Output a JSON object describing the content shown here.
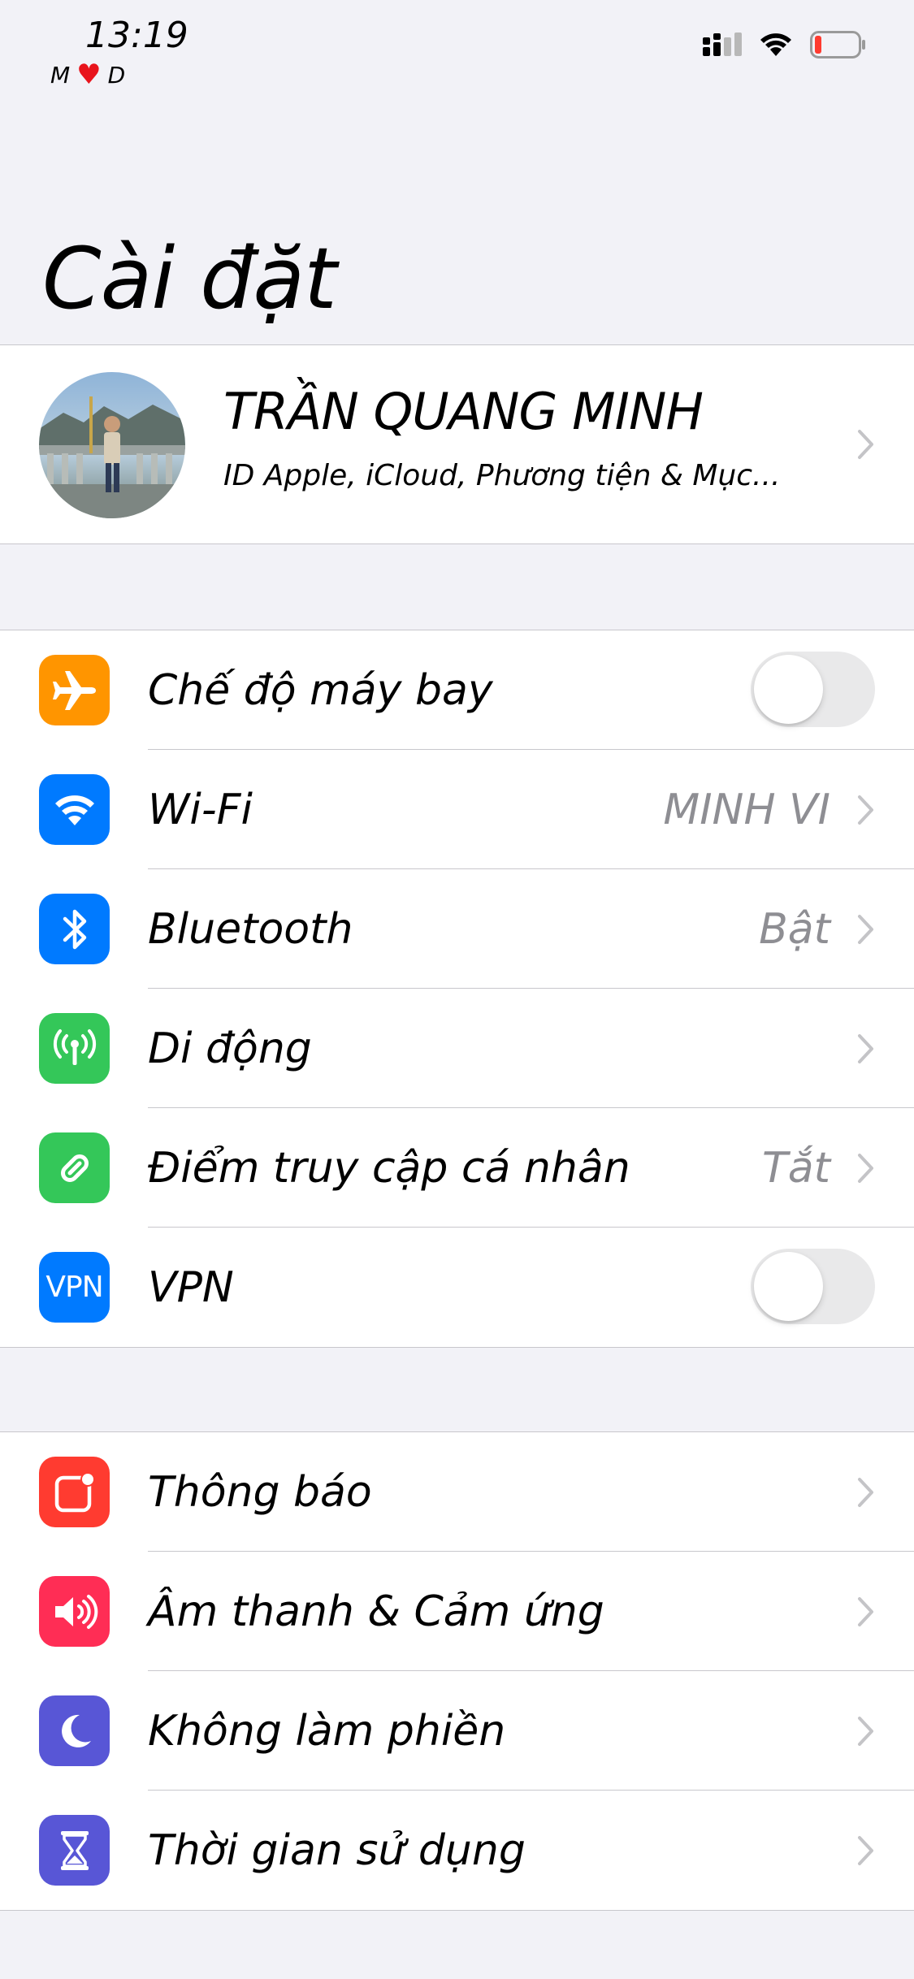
{
  "status_bar": {
    "time": "13:19",
    "carrier_left": "M",
    "carrier_heart": "♥",
    "carrier_right": "D",
    "battery_color": "#ff3b30"
  },
  "page": {
    "title": "Cài đặt"
  },
  "profile": {
    "name": "TRẦN QUANG MINH",
    "subtitle": "ID Apple, iCloud, Phương tiện & Mục..."
  },
  "network_group": {
    "items": [
      {
        "label": "Chế độ máy bay",
        "icon": "airplane-icon",
        "color": "#ff9500",
        "type": "toggle",
        "on": false
      },
      {
        "label": "Wi-Fi",
        "icon": "wifi-icon",
        "color": "#007aff",
        "value": "MINH VI"
      },
      {
        "label": "Bluetooth",
        "icon": "bluetooth-icon",
        "color": "#007aff",
        "value": "Bật"
      },
      {
        "label": "Di động",
        "icon": "cellular-icon",
        "color": "#34c759",
        "value": ""
      },
      {
        "label": "Điểm truy cập cá nhân",
        "icon": "hotspot-icon",
        "color": "#34c759",
        "value": "Tắt"
      },
      {
        "label": "VPN",
        "icon": "vpn-icon",
        "icon_text": "VPN",
        "color": "#007aff",
        "type": "toggle",
        "on": false
      }
    ]
  },
  "notification_group": {
    "items": [
      {
        "label": "Thông báo",
        "icon": "notifications-icon",
        "color": "#ff3b30"
      },
      {
        "label": "Âm thanh & Cảm ứng",
        "icon": "sound-icon",
        "color": "#ff2d55"
      },
      {
        "label": "Không làm phiền",
        "icon": "moon-icon",
        "color": "#5856d6"
      },
      {
        "label": "Thời gian sử dụng",
        "icon": "hourglass-icon",
        "color": "#5856d6"
      }
    ]
  }
}
